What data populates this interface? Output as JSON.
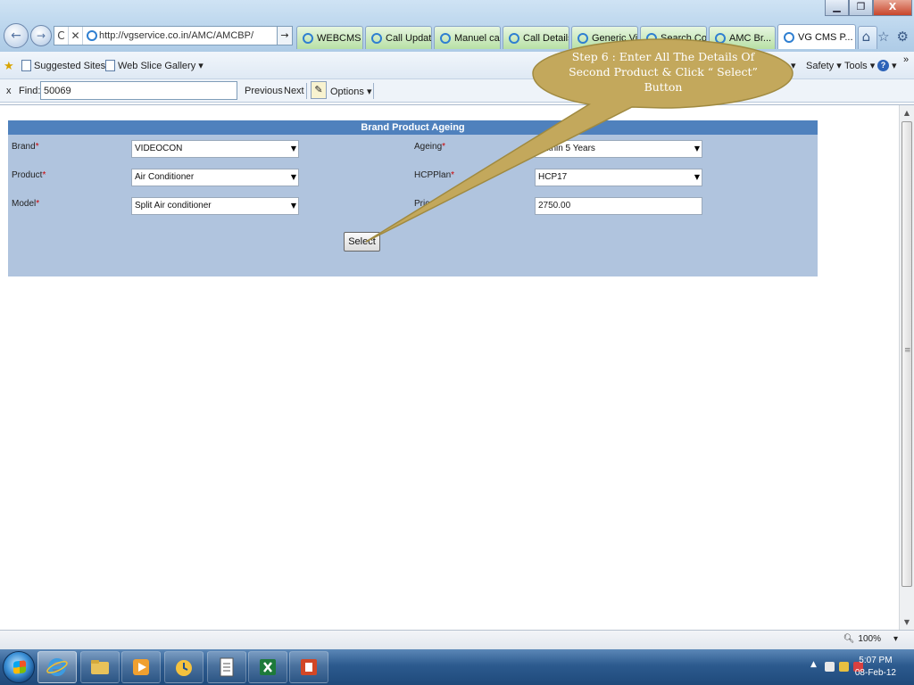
{
  "browser": {
    "window_buttons": [
      "▁",
      "❐",
      "X"
    ],
    "url": "http://vgservice.co.in/AMC/AMCBP/",
    "tabs": [
      {
        "label": "WEBCMS",
        "style": "green"
      },
      {
        "label": "Call Updati...",
        "style": "green"
      },
      {
        "label": "Manuel call...",
        "style": "green"
      },
      {
        "label": "Call Details",
        "style": "green"
      },
      {
        "label": "Generic Vi...",
        "style": "green"
      },
      {
        "label": "Search Co...",
        "style": "green"
      },
      {
        "label": "AMC Br...",
        "style": "green",
        "close": "×"
      },
      {
        "label": "VG CMS P...",
        "style": "active"
      }
    ]
  },
  "favorites": {
    "suggested_sites": "Suggested Sites",
    "web_slice_gallery": "Web Slice Gallery",
    "safety": "Safety",
    "tools": "Tools",
    "more": "»"
  },
  "findbar": {
    "close": "x",
    "label": "Find:",
    "value": "50069",
    "previous": "Previous",
    "next": "Next",
    "options": "Options"
  },
  "form": {
    "title": "Brand Product Ageing",
    "brand": {
      "label": "Brand",
      "value": "VIDEOCON"
    },
    "product": {
      "label": "Product",
      "value": "Air Conditioner"
    },
    "model": {
      "label": "Model",
      "value": "Split Air conditioner"
    },
    "ageing": {
      "label": "Ageing",
      "value": "Within 5 Years"
    },
    "hcp_plan": {
      "label": "HCPPlan",
      "value": "HCP17"
    },
    "price": {
      "label": "Price",
      "value": "2750.00"
    },
    "required_mark": "*",
    "select_button": "Select"
  },
  "callout": {
    "text": "Step  6 : Enter All The Details Of Second Product & Click “ Select” Button",
    "fill": "#c3a85c",
    "stroke": "#a08a40"
  },
  "status": {
    "zoom": "100%"
  },
  "taskbar": {
    "time": "5:07 PM",
    "date": "08-Feb-12"
  }
}
